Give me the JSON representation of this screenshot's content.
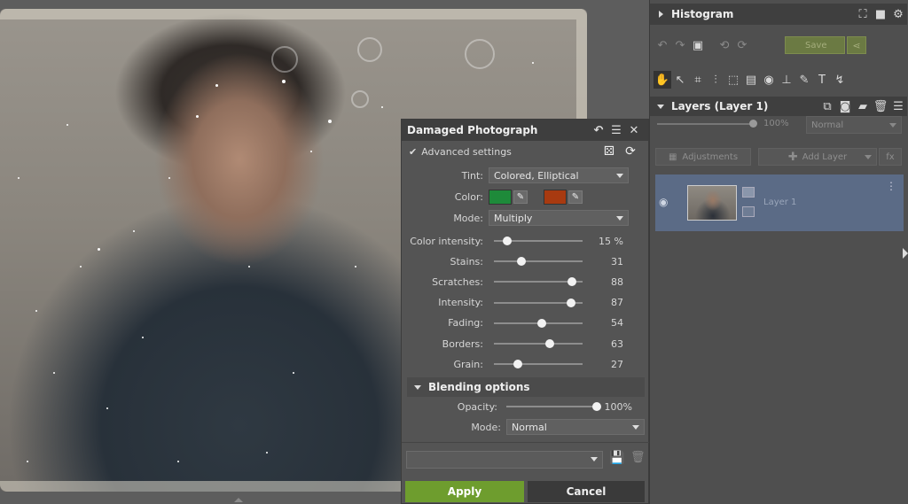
{
  "dialog": {
    "title": "Damaged Photograph",
    "advanced_settings_label": "Advanced settings",
    "tint": {
      "label": "Tint:",
      "value": "Colored, Elliptical"
    },
    "color": {
      "label": "Color:",
      "color1": "#1e8a3a",
      "color2": "#a83a10"
    },
    "mode": {
      "label": "Mode:",
      "value": "Multiply"
    },
    "sliders": [
      {
        "label": "Color intensity:",
        "value": "15 %",
        "level": 15
      },
      {
        "label": "Stains:",
        "value": "31",
        "level": 31
      },
      {
        "label": "Scratches:",
        "value": "88",
        "level": 88
      },
      {
        "label": "Intensity:",
        "value": "87",
        "level": 87
      },
      {
        "label": "Fading:",
        "value": "54",
        "level": 54
      },
      {
        "label": "Borders:",
        "value": "63",
        "level": 63
      },
      {
        "label": "Grain:",
        "value": "27",
        "level": 27
      }
    ],
    "blending": {
      "title": "Blending options",
      "opacity": {
        "label": "Opacity:",
        "value": "100%",
        "level": 100
      },
      "mode": {
        "label": "Mode:",
        "value": "Normal"
      }
    },
    "preset_value": "",
    "apply_label": "Apply",
    "cancel_label": "Cancel",
    "apply_color": "#6e9d2e"
  },
  "right_panel": {
    "histogram_title": "Histogram",
    "save_label": "Save",
    "layers_title": "Layers (Layer 1)",
    "opacity_value": "100%",
    "blend_mode": "Normal",
    "adjustments_label": "Adjustments",
    "add_layer_label": "Add Layer",
    "fx_label": "fx",
    "layer_name": "Layer 1",
    "selected_layer_color": "#5b6b86"
  }
}
